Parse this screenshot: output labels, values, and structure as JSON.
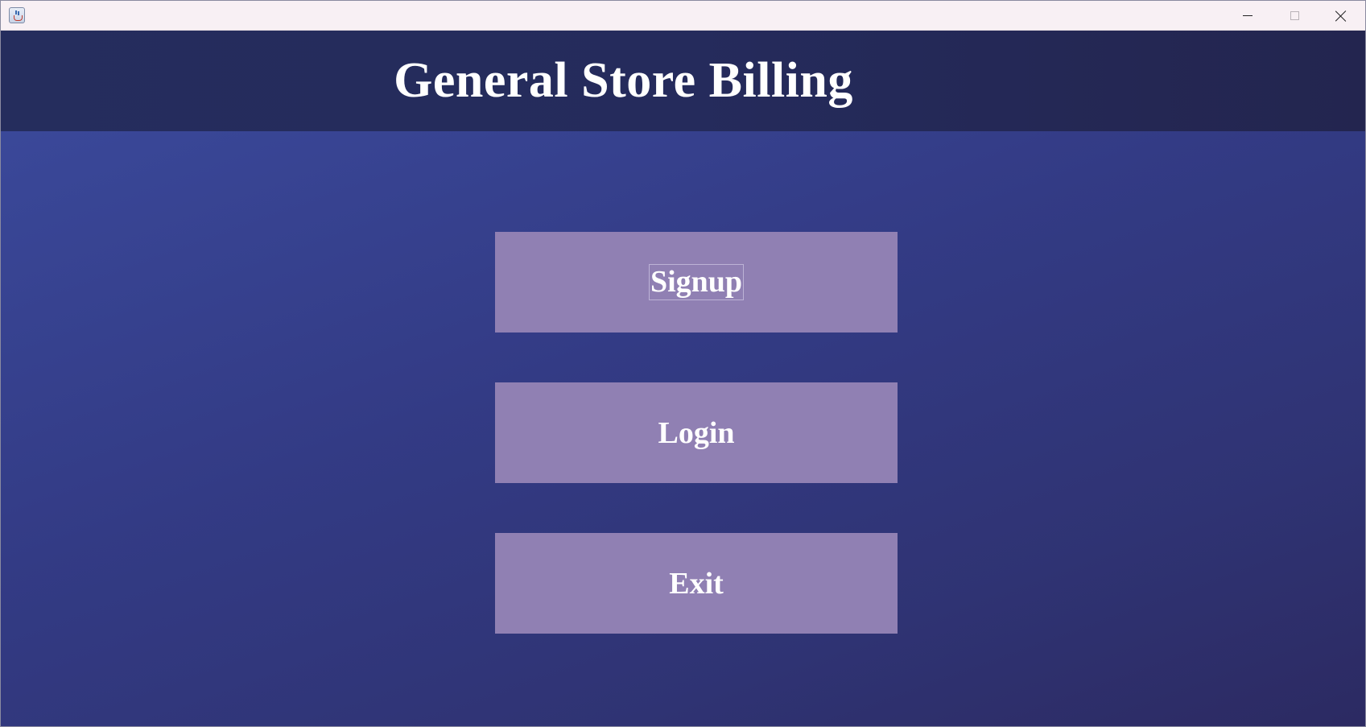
{
  "window": {
    "controls": {
      "minimize_icon": "minimize-icon",
      "maximize_icon": "maximize-icon",
      "close_icon": "close-icon"
    }
  },
  "header": {
    "title": "General Store Billing"
  },
  "menu": {
    "signup_label": "Signup",
    "login_label": "Login",
    "exit_label": "Exit"
  },
  "colors": {
    "header_bg": "#252b5c",
    "content_bg": "#343c88",
    "button_bg": "#9080b3",
    "text": "#ffffff"
  }
}
